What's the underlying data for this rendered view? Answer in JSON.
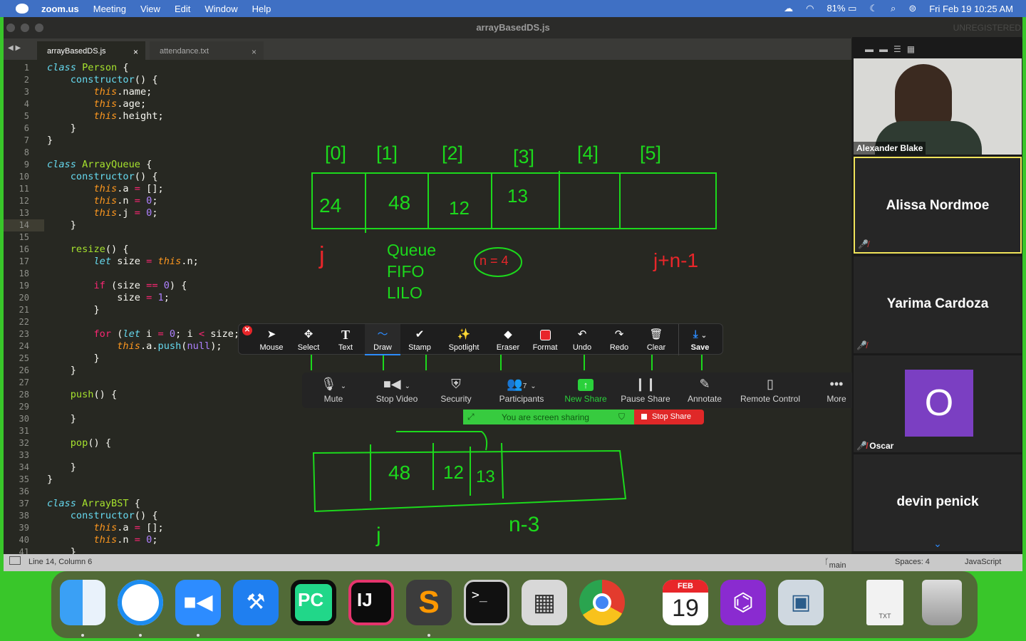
{
  "menubar": {
    "app": "zoom.us",
    "items": [
      "Meeting",
      "View",
      "Edit",
      "Window",
      "Help"
    ],
    "battery": "81%",
    "datetime": "Fri Feb 19  10:25 AM"
  },
  "window": {
    "title": "arrayBasedDS.js",
    "unregistered": "UNREGISTERED"
  },
  "tabs": [
    {
      "label": "arrayBasedDS.js",
      "close": "×"
    },
    {
      "label": "attendance.txt",
      "close": "×"
    }
  ],
  "code": {
    "current_line": 14,
    "lines": [
      [
        {
          "c": "kw",
          "t": "class "
        },
        {
          "c": "fn",
          "t": "Person"
        },
        {
          "t": " {"
        }
      ],
      [
        {
          "t": "    "
        },
        {
          "c": "fnc",
          "t": "constructor"
        },
        {
          "t": "() {"
        }
      ],
      [
        {
          "t": "        "
        },
        {
          "c": "th",
          "t": "this"
        },
        {
          "t": ".name;"
        }
      ],
      [
        {
          "t": "        "
        },
        {
          "c": "th",
          "t": "this"
        },
        {
          "t": ".age;"
        }
      ],
      [
        {
          "t": "        "
        },
        {
          "c": "th",
          "t": "this"
        },
        {
          "t": ".height;"
        }
      ],
      [
        {
          "t": "    }"
        }
      ],
      [
        {
          "t": "}"
        }
      ],
      [
        {
          "t": ""
        }
      ],
      [
        {
          "c": "kw",
          "t": "class "
        },
        {
          "c": "fn",
          "t": "ArrayQueue"
        },
        {
          "t": " {"
        }
      ],
      [
        {
          "t": "    "
        },
        {
          "c": "fnc",
          "t": "constructor"
        },
        {
          "t": "() {"
        }
      ],
      [
        {
          "t": "        "
        },
        {
          "c": "th",
          "t": "this"
        },
        {
          "t": ".a "
        },
        {
          "c": "kr",
          "t": "="
        },
        {
          "t": " [];"
        }
      ],
      [
        {
          "t": "        "
        },
        {
          "c": "th",
          "t": "this"
        },
        {
          "t": ".n "
        },
        {
          "c": "kr",
          "t": "="
        },
        {
          "t": " "
        },
        {
          "c": "nm",
          "t": "0"
        },
        {
          "t": ";"
        }
      ],
      [
        {
          "t": "        "
        },
        {
          "c": "th",
          "t": "this"
        },
        {
          "t": ".j "
        },
        {
          "c": "kr",
          "t": "="
        },
        {
          "t": " "
        },
        {
          "c": "nm",
          "t": "0"
        },
        {
          "t": ";"
        }
      ],
      [
        {
          "t": "    }"
        }
      ],
      [
        {
          "t": ""
        }
      ],
      [
        {
          "t": "    "
        },
        {
          "c": "fn",
          "t": "resize"
        },
        {
          "t": "() {"
        }
      ],
      [
        {
          "t": "        "
        },
        {
          "c": "kw",
          "t": "let"
        },
        {
          "t": " size "
        },
        {
          "c": "kr",
          "t": "="
        },
        {
          "t": " "
        },
        {
          "c": "th",
          "t": "this"
        },
        {
          "t": ".n;"
        }
      ],
      [
        {
          "t": ""
        }
      ],
      [
        {
          "t": "        "
        },
        {
          "c": "kr",
          "t": "if"
        },
        {
          "t": " (size "
        },
        {
          "c": "kr",
          "t": "=="
        },
        {
          "t": " "
        },
        {
          "c": "nm",
          "t": "0"
        },
        {
          "t": ") {"
        }
      ],
      [
        {
          "t": "            size "
        },
        {
          "c": "kr",
          "t": "="
        },
        {
          "t": " "
        },
        {
          "c": "nm",
          "t": "1"
        },
        {
          "t": ";"
        }
      ],
      [
        {
          "t": "        }"
        }
      ],
      [
        {
          "t": ""
        }
      ],
      [
        {
          "t": "        "
        },
        {
          "c": "kr",
          "t": "for"
        },
        {
          "t": " ("
        },
        {
          "c": "kw",
          "t": "let"
        },
        {
          "t": " i "
        },
        {
          "c": "kr",
          "t": "="
        },
        {
          "t": " "
        },
        {
          "c": "nm",
          "t": "0"
        },
        {
          "t": "; i "
        },
        {
          "c": "kr",
          "t": "<"
        },
        {
          "t": " size;"
        }
      ],
      [
        {
          "t": "            "
        },
        {
          "c": "th",
          "t": "this"
        },
        {
          "t": ".a."
        },
        {
          "c": "fnc",
          "t": "push"
        },
        {
          "t": "("
        },
        {
          "c": "nm",
          "t": "null"
        },
        {
          "t": ");"
        }
      ],
      [
        {
          "t": "        }"
        }
      ],
      [
        {
          "t": "    }"
        }
      ],
      [
        {
          "t": ""
        }
      ],
      [
        {
          "t": "    "
        },
        {
          "c": "fn",
          "t": "push"
        },
        {
          "t": "() {"
        }
      ],
      [
        {
          "t": ""
        }
      ],
      [
        {
          "t": "    }"
        }
      ],
      [
        {
          "t": ""
        }
      ],
      [
        {
          "t": "    "
        },
        {
          "c": "fn",
          "t": "pop"
        },
        {
          "t": "() {"
        }
      ],
      [
        {
          "t": ""
        }
      ],
      [
        {
          "t": "    }"
        }
      ],
      [
        {
          "t": "}"
        }
      ],
      [
        {
          "t": ""
        }
      ],
      [
        {
          "c": "kw",
          "t": "class "
        },
        {
          "c": "fn",
          "t": "ArrayBST"
        },
        {
          "t": " {"
        }
      ],
      [
        {
          "t": "    "
        },
        {
          "c": "fnc",
          "t": "constructor"
        },
        {
          "t": "() {"
        }
      ],
      [
        {
          "t": "        "
        },
        {
          "c": "th",
          "t": "this"
        },
        {
          "t": ".a "
        },
        {
          "c": "kr",
          "t": "="
        },
        {
          "t": " [];"
        }
      ],
      [
        {
          "t": "        "
        },
        {
          "c": "th",
          "t": "this"
        },
        {
          "t": ".n "
        },
        {
          "c": "kr",
          "t": "="
        },
        {
          "t": " "
        },
        {
          "c": "nm",
          "t": "0"
        },
        {
          "t": ";"
        }
      ],
      [
        {
          "t": "    }"
        }
      ]
    ]
  },
  "handwriting": {
    "indices": [
      "[0]",
      "[1]",
      "[2]",
      "[3]",
      "[4]",
      "[5]"
    ],
    "cells": [
      "24",
      "48",
      "12",
      "13",
      "",
      ""
    ],
    "j": "j",
    "queue": "Queue",
    "fifo": "FIFO",
    "lilo": "LILO",
    "n4": "n = 4",
    "jn": "j+n-1",
    "cells2": [
      "48",
      "12",
      "13"
    ],
    "n3": "n-3",
    "j2": "j"
  },
  "annotate": {
    "items": [
      "Mouse",
      "Select",
      "Text",
      "Draw",
      "Stamp",
      "Spotlight",
      "Eraser",
      "Format",
      "Undo",
      "Redo",
      "Clear",
      "Save"
    ]
  },
  "zoom_bar": {
    "items": [
      "Mute",
      "Stop Video",
      "Security",
      "Participants",
      "New Share",
      "Pause Share",
      "Annotate",
      "Remote Control",
      "More"
    ],
    "participant_count": "7"
  },
  "share": {
    "status": "You are screen sharing",
    "stop": "Stop Share"
  },
  "participants": [
    {
      "name": "Alexander Blake"
    },
    {
      "name": "Alissa Nordmoe"
    },
    {
      "name": "Yarima Cardoza"
    },
    {
      "name": "Oscar",
      "initial": "O"
    },
    {
      "name": "devin penick"
    }
  ],
  "status": {
    "position": "Line 14, Column 6",
    "branch": "main",
    "spaces": "Spaces: 4",
    "syntax": "JavaScript"
  },
  "dock": {
    "calendar_month": "FEB",
    "calendar_day": "19",
    "txt": "TXT"
  },
  "colors": {
    "draw": "#1cd91c",
    "red": "#e8262a",
    "menubar": "#3f70c4",
    "oscar": "#7b3fc2"
  }
}
